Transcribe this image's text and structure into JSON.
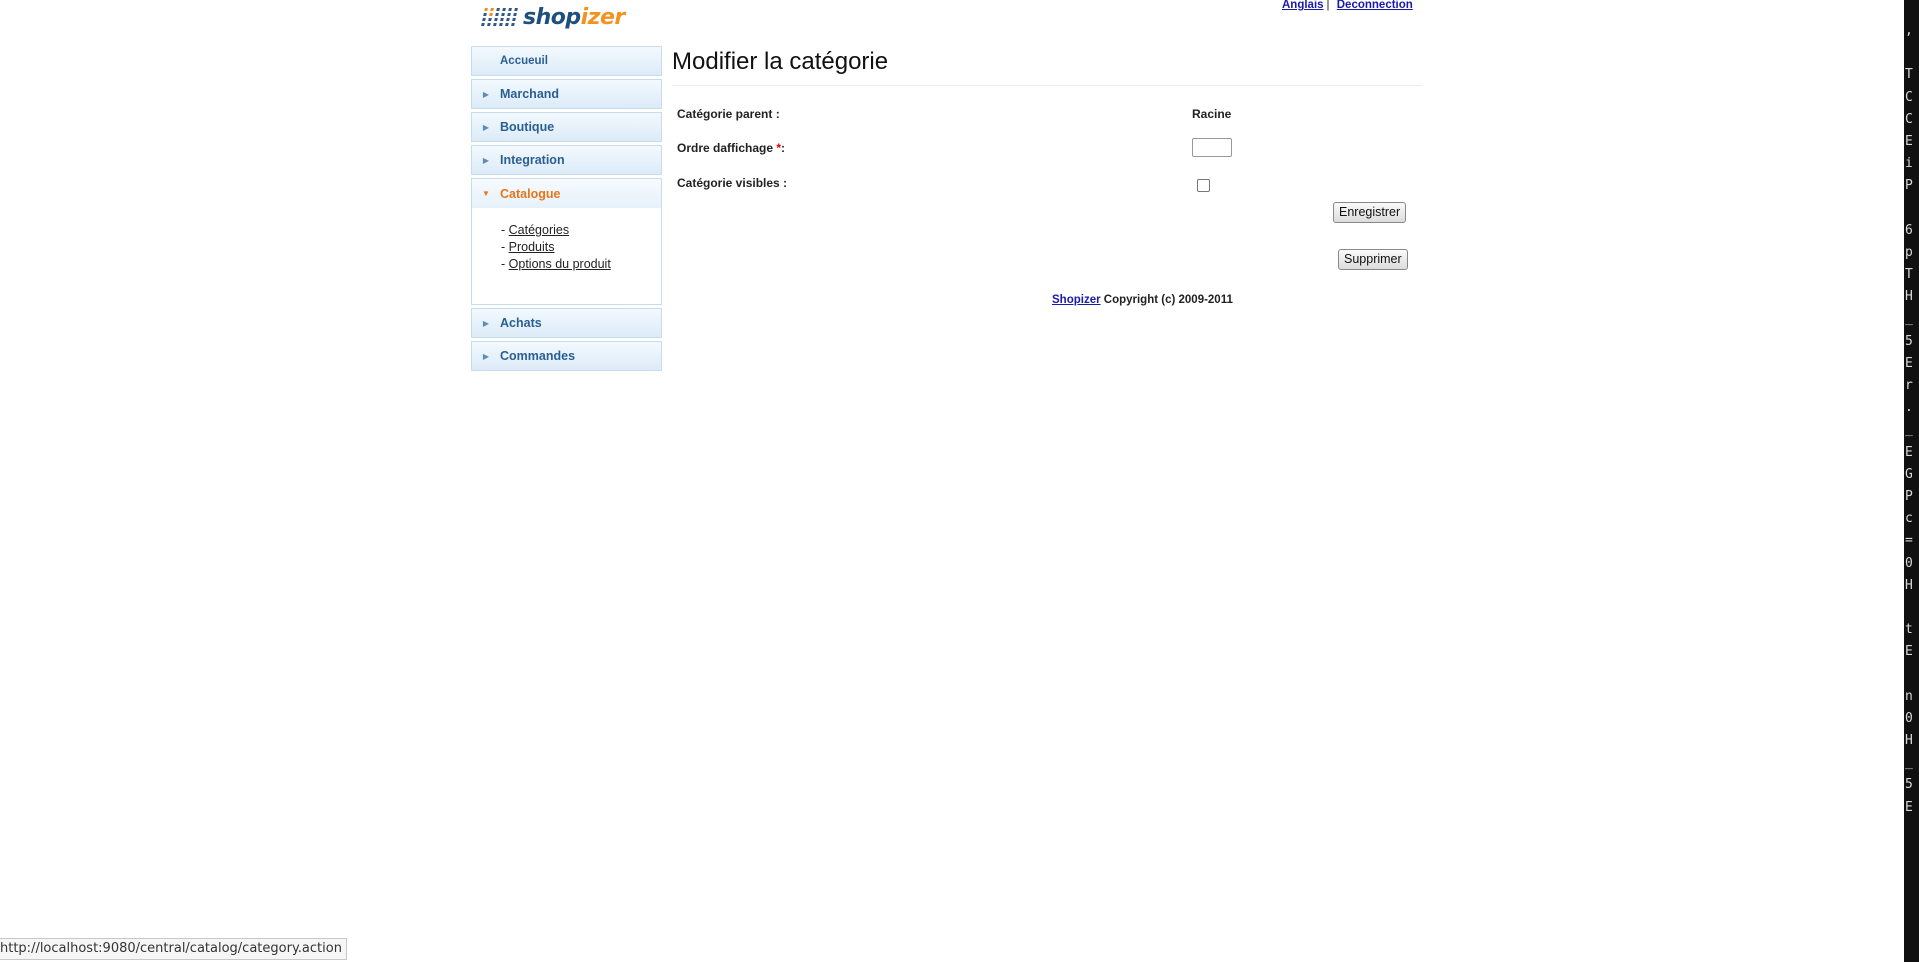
{
  "header": {
    "logo_text_a": "shop",
    "logo_text_b": "izer",
    "lang_link": "Anglais",
    "separator": "|",
    "logout_link": "Deconnection"
  },
  "sidebar": {
    "home": "Accueuil",
    "items": [
      {
        "label": "Marchand"
      },
      {
        "label": "Boutique"
      },
      {
        "label": "Integration"
      },
      {
        "label": "Catalogue"
      },
      {
        "label": "Achats"
      },
      {
        "label": "Commandes"
      }
    ],
    "submenu_prefix": "-",
    "submenu": [
      "Catégories",
      "Produits",
      "Options du produit"
    ]
  },
  "main": {
    "title": "Modifier la catégorie",
    "parent_label": "Catégorie parent :",
    "parent_value": "Racine",
    "order_label": "Ordre daffichage ",
    "required_mark": "*",
    "order_colon": ":",
    "order_value": "",
    "visible_label": "Catégorie visibles :",
    "visible_checked": false,
    "save_button": "Enregistrer",
    "delete_button": "Supprimer"
  },
  "footer": {
    "link": "Shopizer",
    "text": " Copyright (c) 2009-2011"
  },
  "statusbar": {
    "url": "http://localhost:9080/central/catalog/category.action"
  },
  "terminal": {
    "glyphs": [
      ",",
      "",
      "T",
      "C",
      "C",
      "E",
      "i",
      "P",
      "",
      "6",
      "p",
      "T",
      "H",
      "_",
      "5",
      "E",
      "r",
      ".",
      "_",
      "E",
      "G",
      "P",
      "c",
      "=",
      "0",
      "H",
      "",
      "t",
      "E",
      "",
      "n",
      "0",
      "H",
      "_",
      "5",
      "E"
    ]
  },
  "colors": {
    "nav_text": "#2b5f94",
    "nav_active": "#e8751a",
    "link": "#1a1aa8",
    "logo_blue": "#1f4f7e",
    "logo_orange": "#f39221"
  }
}
